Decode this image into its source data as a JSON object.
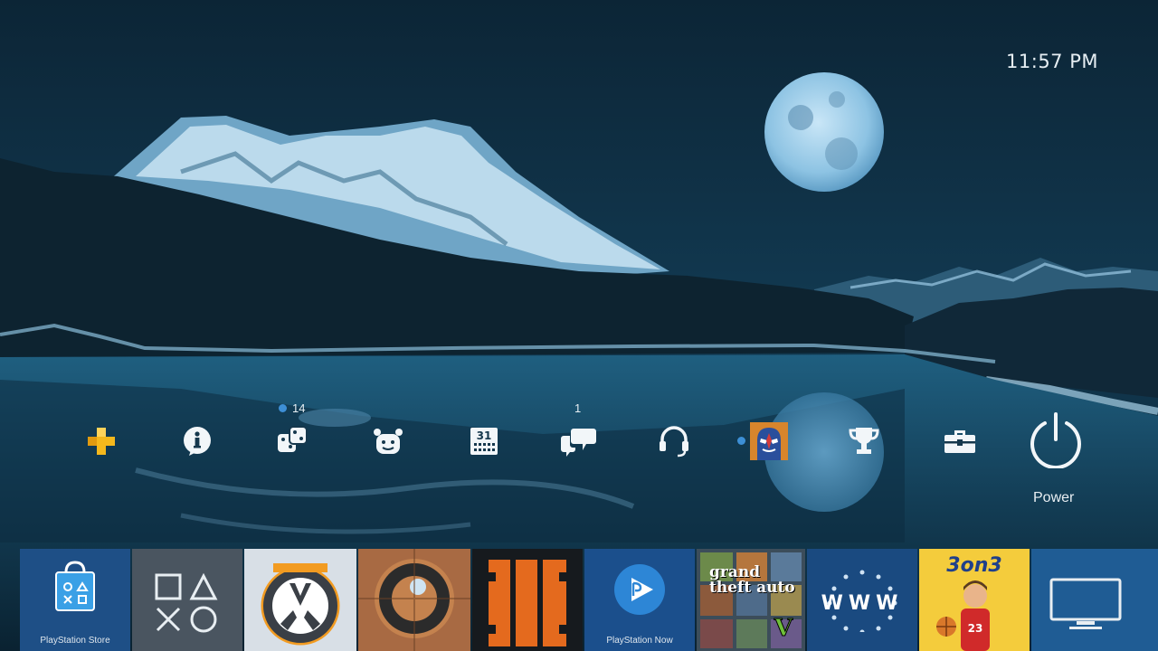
{
  "clock": {
    "time": "11:57 PM"
  },
  "function_bar": {
    "items": [
      {
        "name": "playstation-plus",
        "icon": "ps-plus-icon"
      },
      {
        "name": "whats-new",
        "icon": "info-icon"
      },
      {
        "name": "notifications",
        "icon": "dice-icon",
        "badge": "14",
        "indicator": true
      },
      {
        "name": "friends",
        "icon": "friends-icon"
      },
      {
        "name": "events",
        "icon": "calendar-icon",
        "calendar_day": "31"
      },
      {
        "name": "messages",
        "icon": "messages-icon",
        "badge": "1"
      },
      {
        "name": "party",
        "icon": "headset-icon"
      },
      {
        "name": "profile",
        "icon": "avatar-icon",
        "indicator": true
      },
      {
        "name": "trophies",
        "icon": "trophy-icon"
      },
      {
        "name": "settings",
        "icon": "toolbox-icon"
      },
      {
        "name": "power",
        "icon": "power-icon",
        "label": "Power"
      }
    ]
  },
  "content_tiles": [
    {
      "name": "playstation-store",
      "label": "PlayStation Store",
      "icon": "store-bag-icon"
    },
    {
      "name": "library",
      "icon": "ps-shapes-icon"
    },
    {
      "name": "overwatch",
      "icon": "overwatch-logo-icon"
    },
    {
      "name": "rocket-game",
      "icon": "game-art-icon"
    },
    {
      "name": "black-ops-3",
      "icon": "black-ops-logo-icon"
    },
    {
      "name": "playstation-now",
      "label": "PlayStation Now",
      "icon": "ps-now-icon"
    },
    {
      "name": "gta-v",
      "art_text": "grand theft auto",
      "icon": "gta-art-icon"
    },
    {
      "name": "internet-browser",
      "label": "WWW",
      "icon": "www-icon"
    },
    {
      "name": "3on3-freestyle",
      "art_text": "3on3",
      "icon": "basketball-art-icon"
    },
    {
      "name": "tv-video",
      "icon": "tv-icon"
    }
  ],
  "colors": {
    "accent": "#3d8fd6",
    "ps_plus": "#f5b81c",
    "tile_blue": "#1e4f86"
  }
}
